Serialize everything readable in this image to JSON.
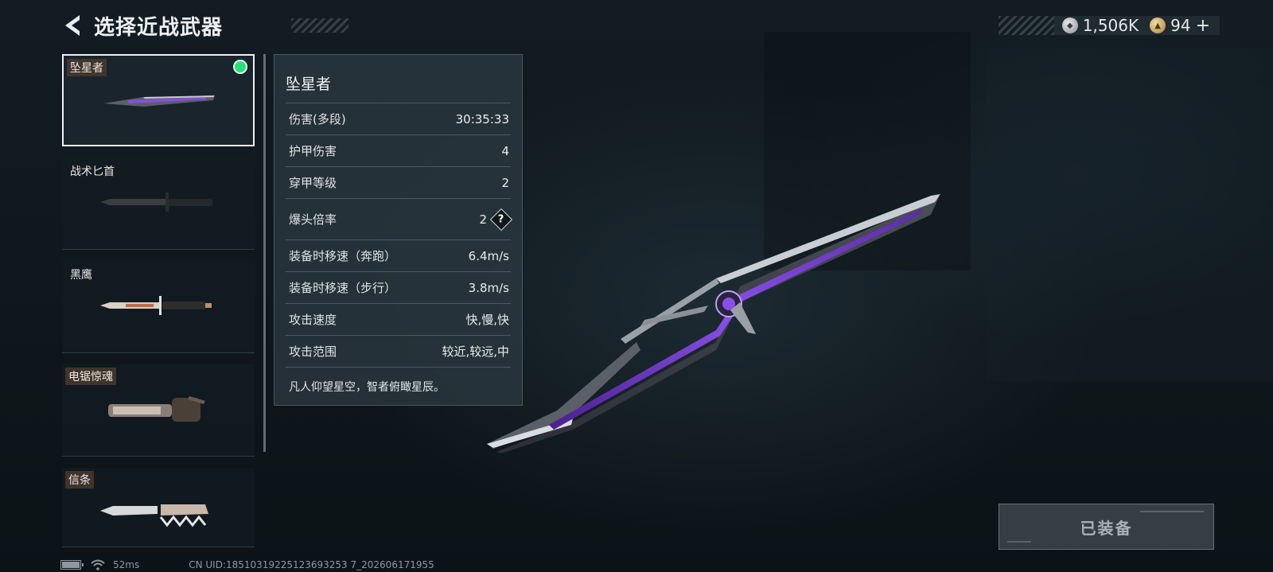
{
  "header": {
    "title": "选择近战武器"
  },
  "currency": {
    "silver_value": "1,506K",
    "gold_value": "94",
    "plus_symbol": "+"
  },
  "weapons": [
    {
      "name": "坠星者",
      "selected": true,
      "equipped": true
    },
    {
      "name": "战术匕首",
      "selected": false,
      "equipped": false
    },
    {
      "name": "黑鹰",
      "selected": false,
      "equipped": false
    },
    {
      "name": "电锯惊魂",
      "selected": false,
      "equipped": false
    },
    {
      "name": "信条",
      "selected": false,
      "equipped": false
    }
  ],
  "stats": {
    "title": "坠星者",
    "rows": [
      {
        "label": "伤害(多段)",
        "value": "30:35:33"
      },
      {
        "label": "护甲伤害",
        "value": "4"
      },
      {
        "label": "穿甲等级",
        "value": "2"
      },
      {
        "label": "爆头倍率",
        "value": "2"
      },
      {
        "label": "装备时移速（奔跑）",
        "value": "6.4m/s"
      },
      {
        "label": "装备时移速（步行）",
        "value": "3.8m/s"
      },
      {
        "label": "攻击速度",
        "value": "快,慢,快"
      },
      {
        "label": "攻击范围",
        "value": "较近,较远,中"
      }
    ],
    "description": "凡人仰望星空，智者俯瞰星辰。",
    "help_symbol": "?"
  },
  "equip_button": {
    "label": "已装备"
  },
  "status_bar": {
    "ping": "52ms",
    "uid": "CN UID:18510319225123693253 7_202606171955"
  },
  "colors": {
    "equipped_dot": "#27e07a",
    "label_bg": "#4a3a2e",
    "accent_purple": "#7b3fd0"
  },
  "icons": {
    "back": "back-arrow-icon",
    "silver_coin": "silver-coin-icon",
    "gold_coin": "gold-coin-icon",
    "help": "help-icon",
    "battery": "battery-icon",
    "wifi": "wifi-icon"
  }
}
